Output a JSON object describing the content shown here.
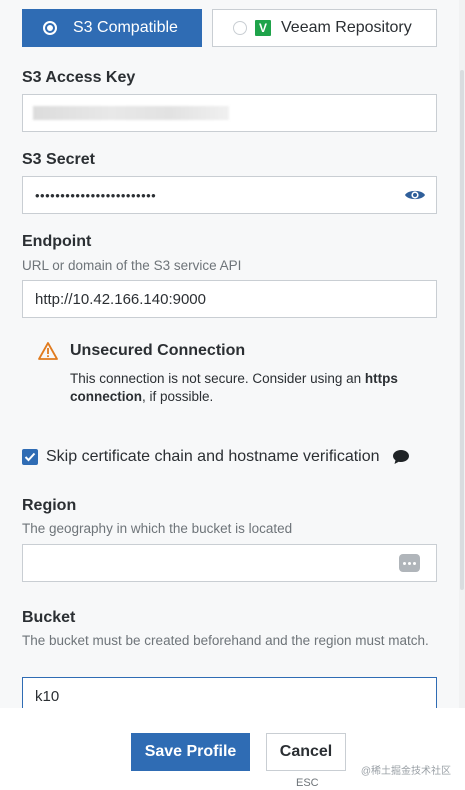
{
  "storage_type": {
    "options": [
      {
        "label": "S3 Compatible",
        "selected": true
      },
      {
        "label": "Veeam Repository",
        "selected": false,
        "logo_letter": "V"
      }
    ]
  },
  "access_key": {
    "label": "S3 Access Key",
    "value": ""
  },
  "secret": {
    "label": "S3 Secret",
    "value": "••••••••••••••••••••••••"
  },
  "endpoint": {
    "label": "Endpoint",
    "help": "URL or domain of the S3 service API",
    "value": "http://10.42.166.140:9000"
  },
  "warning": {
    "title": "Unsecured Connection",
    "body_pre": "This connection is not secure. Consider using an ",
    "body_bold": "https connection",
    "body_post": ", if possible.",
    "icon_color": "#e07b1f"
  },
  "skip_verification": {
    "label": "Skip certificate chain and hostname verification",
    "checked": true
  },
  "region": {
    "label": "Region",
    "help": "The geography in which the bucket is located",
    "value": ""
  },
  "bucket": {
    "label": "Bucket",
    "help": "The bucket must be created beforehand and the region must match.",
    "value": "k10"
  },
  "footer": {
    "save_label": "Save Profile",
    "cancel_label": "Cancel",
    "cancel_shortcut": "ESC",
    "watermark": "@稀土掘金技术社区"
  },
  "colors": {
    "accent": "#2f6cb4",
    "veeam_green": "#1fa34a"
  }
}
